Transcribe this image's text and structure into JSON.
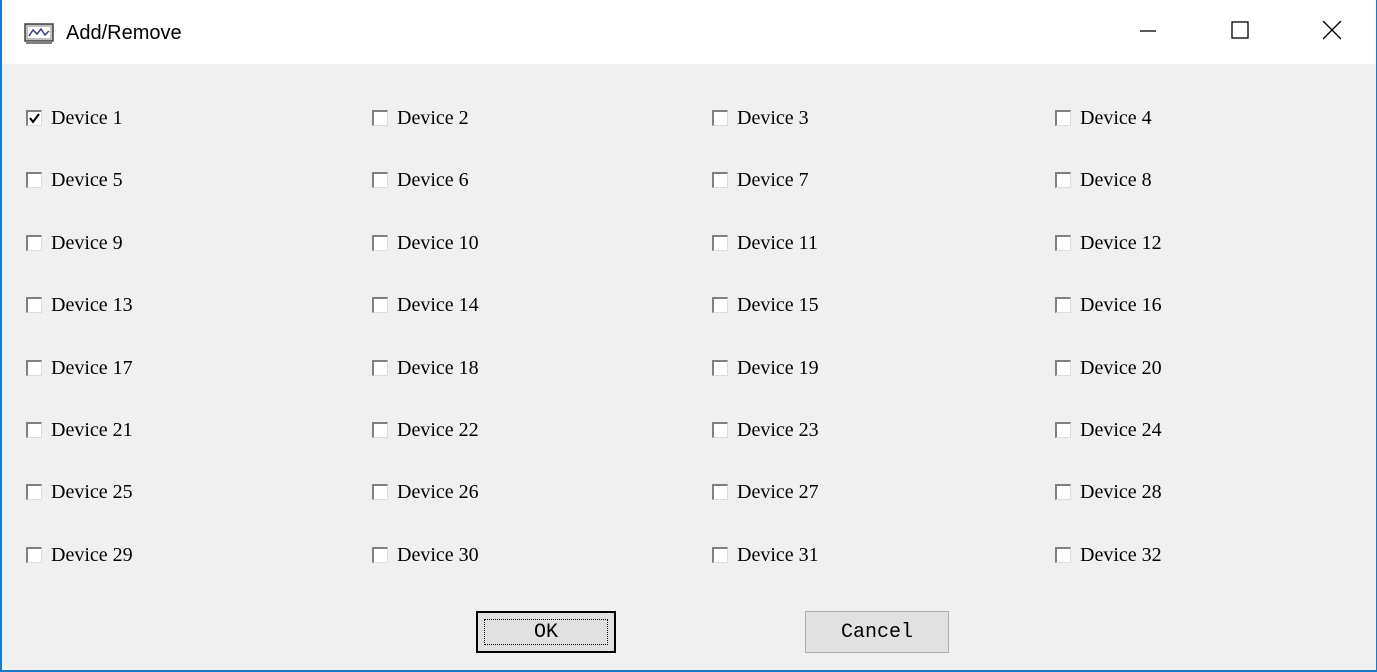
{
  "window": {
    "title": "Add/Remove",
    "icon": "monitor-app-icon",
    "controls": {
      "minimize_icon": "minimize-icon",
      "maximize_icon": "maximize-icon",
      "close_icon": "close-icon"
    }
  },
  "devices": [
    {
      "label": "Device 1",
      "checked": true
    },
    {
      "label": "Device 2",
      "checked": false
    },
    {
      "label": "Device 3",
      "checked": false
    },
    {
      "label": "Device 4",
      "checked": false
    },
    {
      "label": "Device 5",
      "checked": false
    },
    {
      "label": "Device 6",
      "checked": false
    },
    {
      "label": "Device 7",
      "checked": false
    },
    {
      "label": "Device 8",
      "checked": false
    },
    {
      "label": "Device 9",
      "checked": false
    },
    {
      "label": "Device 10",
      "checked": false
    },
    {
      "label": "Device 11",
      "checked": false
    },
    {
      "label": "Device 12",
      "checked": false
    },
    {
      "label": "Device 13",
      "checked": false
    },
    {
      "label": "Device 14",
      "checked": false
    },
    {
      "label": "Device 15",
      "checked": false
    },
    {
      "label": "Device 16",
      "checked": false
    },
    {
      "label": "Device 17",
      "checked": false
    },
    {
      "label": "Device 18",
      "checked": false
    },
    {
      "label": "Device 19",
      "checked": false
    },
    {
      "label": "Device 20",
      "checked": false
    },
    {
      "label": "Device 21",
      "checked": false
    },
    {
      "label": "Device 22",
      "checked": false
    },
    {
      "label": "Device 23",
      "checked": false
    },
    {
      "label": "Device 24",
      "checked": false
    },
    {
      "label": "Device 25",
      "checked": false
    },
    {
      "label": "Device 26",
      "checked": false
    },
    {
      "label": "Device 27",
      "checked": false
    },
    {
      "label": "Device 28",
      "checked": false
    },
    {
      "label": "Device 29",
      "checked": false
    },
    {
      "label": "Device 30",
      "checked": false
    },
    {
      "label": "Device 31",
      "checked": false
    },
    {
      "label": "Device 32",
      "checked": false
    }
  ],
  "buttons": {
    "ok_label": "OK",
    "cancel_label": "Cancel"
  },
  "colors": {
    "window_border": "#1979ca",
    "dialog_background": "#f0f0f0",
    "button_face": "#e1e1e1"
  }
}
